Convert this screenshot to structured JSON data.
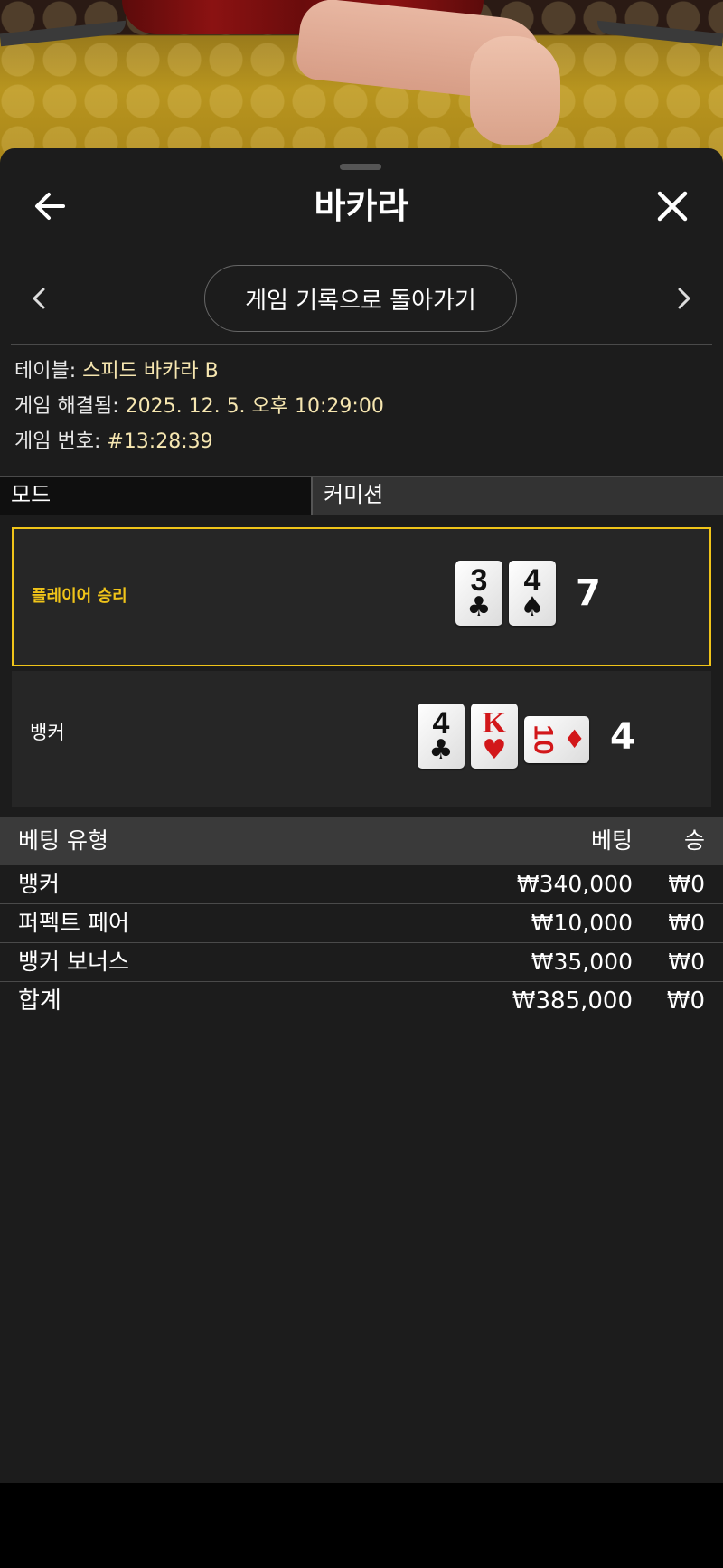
{
  "header": {
    "title": "바카라"
  },
  "history_button": {
    "label": "게임 기록으로 돌아가기"
  },
  "info": [
    {
      "label": "테이블:",
      "value": "스피드 바카라 B"
    },
    {
      "label": "게임 해결됨:",
      "value": "2025. 12. 5. 오후 10:29:00"
    },
    {
      "label": "게임 번호:",
      "value": "#13:28:39"
    }
  ],
  "tabs": {
    "mode": "모드",
    "commission": "커미션"
  },
  "result": {
    "player": {
      "label": "플레이어 승리",
      "score": "7",
      "cards": [
        {
          "rank": "3",
          "suit": "♣"
        },
        {
          "rank": "4",
          "suit": "♠"
        }
      ]
    },
    "banker": {
      "label": "뱅커",
      "score": "4",
      "cards": [
        {
          "rank": "4",
          "suit": "♣"
        },
        {
          "rank": "K",
          "suit": "♥"
        },
        {
          "rank": "10",
          "suit": "♦"
        }
      ]
    }
  },
  "bets": {
    "headers": {
      "type": "베팅 유형",
      "bet": "베팅",
      "win": "승"
    },
    "rows": [
      {
        "type": "뱅커",
        "bet": "₩340,000",
        "win": "₩0"
      },
      {
        "type": "퍼펙트 페어",
        "bet": "₩10,000",
        "win": "₩0"
      },
      {
        "type": "뱅커 보너스",
        "bet": "₩35,000",
        "win": "₩0"
      }
    ],
    "total": {
      "type": "합계",
      "bet": "₩385,000",
      "win": "₩0"
    }
  },
  "colors": {
    "accent": "#f0c419",
    "sheet_bg": "#1c1c1c",
    "card_red": "#d2171a"
  },
  "icons": {
    "back": "arrow-left-icon",
    "close": "close-icon",
    "prev": "chevron-left-icon",
    "next": "chevron-right-icon"
  }
}
